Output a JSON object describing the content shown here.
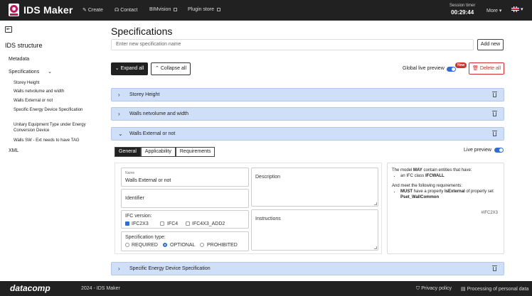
{
  "topbar": {
    "brand": "IDS Maker",
    "nav": [
      {
        "label": "Create",
        "icon": "pencil-icon"
      },
      {
        "label": "Contact",
        "icon": "headset-icon"
      },
      {
        "label": "BIMvision",
        "icon": "external-link-icon"
      },
      {
        "label": "Plugin store",
        "icon": "external-link-icon"
      }
    ],
    "session_timer_label": "Session timer",
    "session_timer_value": "00:29:44",
    "more_label": "More",
    "language": "en-GB"
  },
  "sidebar": {
    "title": "IDS structure",
    "metadata": "Metadata",
    "specifications": "Specifications",
    "spec_items": [
      "Storey Height",
      "Walls netvolume and width",
      "Walls External or not",
      "Specific Energy Device Specification",
      "Unitary Equipment Type under Energy Conversion Device",
      "Walls SW - Ext needs to have TAG"
    ],
    "xml": "XML"
  },
  "main": {
    "title": "Specifications",
    "new_spec_placeholder": "Enter new specification name",
    "add_new": "Add new",
    "expand_all": "Expand all",
    "collapse_all": "Collapse all",
    "global_live_preview": "Global live preview",
    "new_badge": "New",
    "delete_all": "Delete all",
    "specs": [
      {
        "name": "Storey Height"
      },
      {
        "name": "Walls netvolume and width"
      },
      {
        "name": "Walls External or not"
      },
      {
        "name": "Specific Energy Device Specification"
      }
    ],
    "tabs": [
      "General",
      "Applicability",
      "Requirements"
    ],
    "live_preview": "Live preview",
    "form": {
      "name_label": "Name",
      "name_value": "Walls External or not",
      "identifier_label": "Identifier",
      "description_label": "Description",
      "instructions_label": "Instructions",
      "ifc_version_label": "IFC version:",
      "ifc_versions": [
        "IFC2X3",
        "IFC4",
        "IFC4X3_ADD2"
      ],
      "spec_type_label": "Specification type:",
      "spec_types": [
        "REQUIRED",
        "OPTIONAL",
        "PROHIBITED"
      ]
    },
    "preview": {
      "line1_pre": "The model ",
      "line1_bold": "MAY",
      "line1_post": " contain entities that have:",
      "item1_pre": "an IFC class ",
      "item1_bold": "IFCWALL",
      "line2": "And meet the following requirements:",
      "item2_b1": "MUST",
      "item2_mid": " have a property ",
      "item2_b2": "IsExternal",
      "item2_post": " of property set ",
      "item2_b3": "Pset_WallCommon",
      "tag": "#IFC2X3"
    }
  },
  "footer": {
    "brand": "datacomp",
    "copyright": "2024 - IDS Maker",
    "privacy": "Privacy policy",
    "processing": "Processing of personal data"
  },
  "colors": {
    "accent": "#2b6ed8",
    "spec_row_bg": "#cfdff7",
    "danger": "#d32f2f",
    "topbar": "#212121"
  }
}
